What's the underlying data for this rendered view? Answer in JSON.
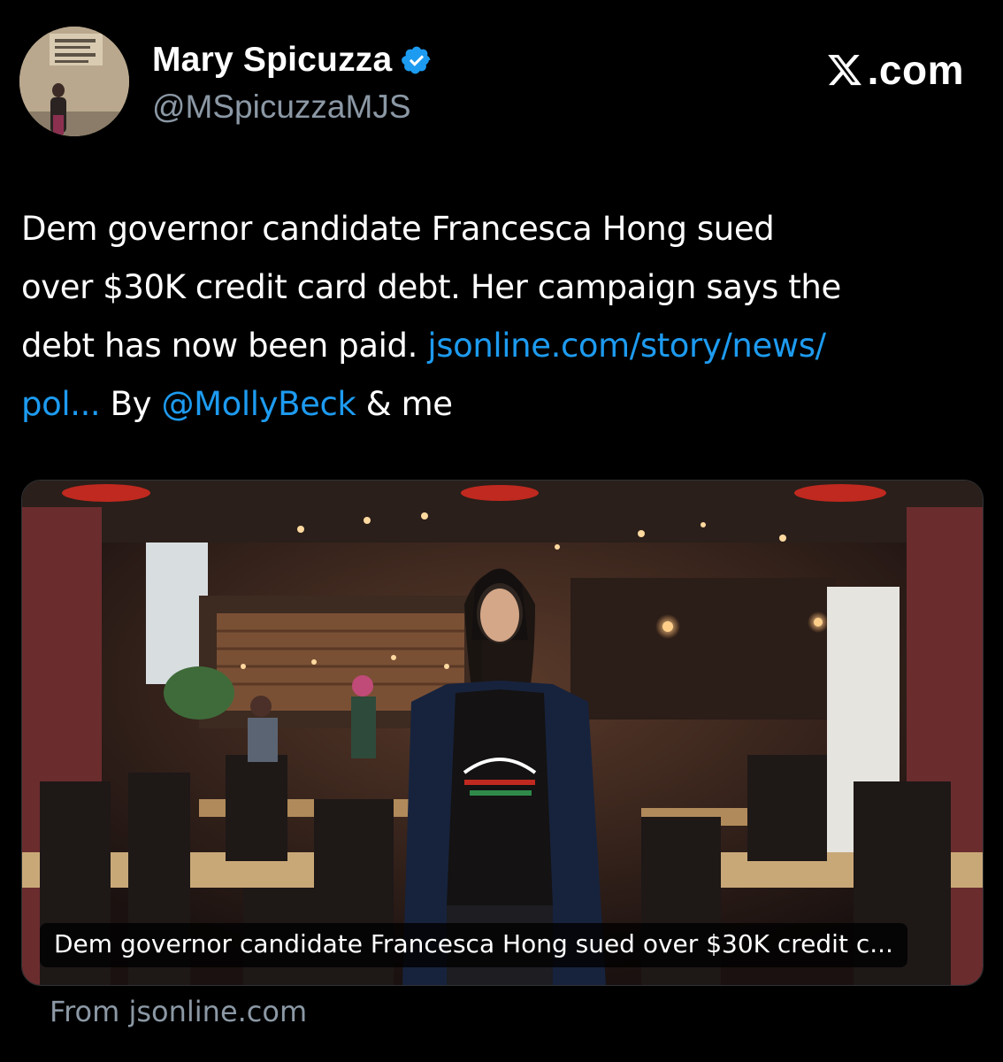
{
  "author": {
    "display_name": "Mary Spicuzza",
    "handle": "@MSpicuzzaMJS",
    "verified": true,
    "avatar_icon": "profile-photo"
  },
  "brand": {
    "text": ".com",
    "logo_icon": "x-logo-icon"
  },
  "tweet": {
    "line1": "Dem governor candidate Francesca Hong sued",
    "line2": "over $30K credit card debt. Her campaign says the",
    "line3_text": "debt has now been paid. ",
    "line3_link": "jsonline.com/story/news/",
    "line4_link": "pol...",
    "line4_by": " By ",
    "line4_mention": "@MollyBeck",
    "line4_tail": " & me"
  },
  "card": {
    "caption": "Dem governor candidate Francesca Hong sued over $30K credit c...",
    "source": "From jsonline.com"
  },
  "colors": {
    "background": "#000000",
    "text": "#ffffff",
    "secondary": "#8b98a5",
    "link": "#1d9bf0",
    "verified": "#1d9bf0"
  }
}
